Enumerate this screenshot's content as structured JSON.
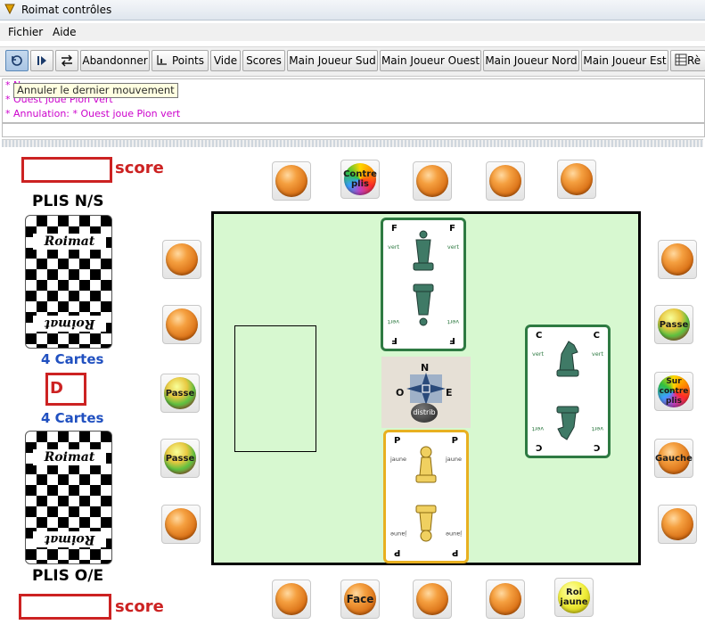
{
  "window": {
    "title": "Roimat contrôles"
  },
  "menu": {
    "items": [
      "Fichier",
      "Aide"
    ]
  },
  "toolbar": {
    "buttons": [
      "Abandonner",
      "Points",
      "Vide",
      "Scores",
      "Main Joueur Sud",
      "Main Joueur Ouest",
      "Main Joueur Nord",
      "Main Joueur Est",
      "Rè"
    ]
  },
  "log": {
    "lines": [
      "* N",
      "* Ouest joue Pion vert",
      "* Annulation: * Ouest joue Pion vert"
    ]
  },
  "tooltip": {
    "text": "Annuler le dernier mouvement"
  },
  "board": {
    "score_label": "score",
    "plis_ns": "PLIS N/S",
    "plis_oe": "PLIS O/E",
    "cartes_top": "4 Cartes",
    "cartes_bottom": "4 Cartes",
    "dealer_marker": "D",
    "deck_brand": "Roimat",
    "compass": {
      "n": "N",
      "s": "",
      "e": "E",
      "o": "O",
      "distrib": "distrib"
    },
    "buttons": {
      "contre_plis": "Contre plis",
      "passe": "Passe",
      "sur_contre_plis": "Sur contre plis",
      "gauche": "Gauche",
      "face": "Face",
      "roi_jaune": "Roi jaune"
    },
    "cards": {
      "north": {
        "rank": "F",
        "color": "vert"
      },
      "east": {
        "rank": "C",
        "color": "vert"
      },
      "south": {
        "rank": "P",
        "color": "jaune"
      }
    }
  },
  "colors": {
    "accent_red": "#cc2222",
    "cartes_blue": "#2050c0",
    "table_green": "#d7f8d0",
    "log_magenta": "#cc00cc"
  }
}
